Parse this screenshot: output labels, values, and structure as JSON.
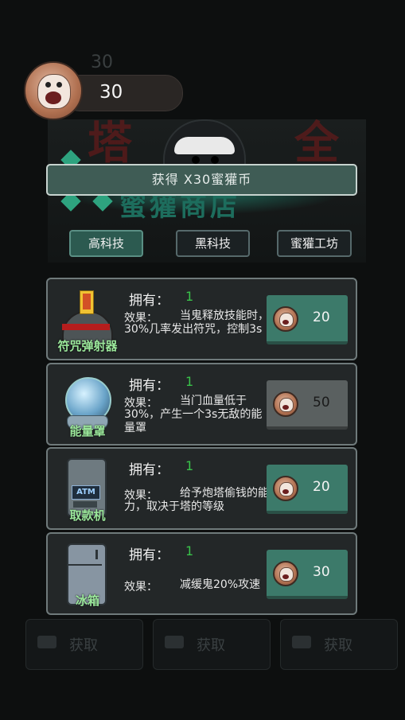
{
  "background": {
    "level_number": "30",
    "watch_ad_label": "获取"
  },
  "currency": {
    "amount": "30",
    "icon": "badger-coin-icon"
  },
  "toast": {
    "message": "获得 X30蜜獾币"
  },
  "tabs": [
    {
      "label": "高科技",
      "active": true
    },
    {
      "label": "黑科技",
      "active": false
    },
    {
      "label": "蜜獾工坊",
      "active": false
    }
  ],
  "items": [
    {
      "name": "符咒弹射器",
      "own_label": "拥有：",
      "own_count": "1",
      "effect_label": "效果：",
      "effect": "当鬼释放技能时，30%几率发出符咒，控制3s",
      "price": "20",
      "affordable": true
    },
    {
      "name": "能量罩",
      "own_label": "拥有：",
      "own_count": "1",
      "effect_label": "效果：",
      "effect": "当门血量低于30%，产生一个3s无敌的能量罩",
      "price": "50",
      "affordable": false
    },
    {
      "name": "取款机",
      "own_label": "拥有：",
      "own_count": "1",
      "effect_label": "效果：",
      "effect": "给予炮塔偷钱的能力，取决于塔的等级",
      "price": "20",
      "affordable": true,
      "art_text": "ATM"
    },
    {
      "name": "冰箱",
      "own_label": "拥有：",
      "own_count": "1",
      "effect_label": "效果：",
      "effect": "减缓鬼20%攻速",
      "price": "30",
      "affordable": true
    }
  ],
  "colors": {
    "accent_green": "#3c7a6a",
    "owned_count": "#39c24a",
    "item_name": "#9be89b"
  }
}
